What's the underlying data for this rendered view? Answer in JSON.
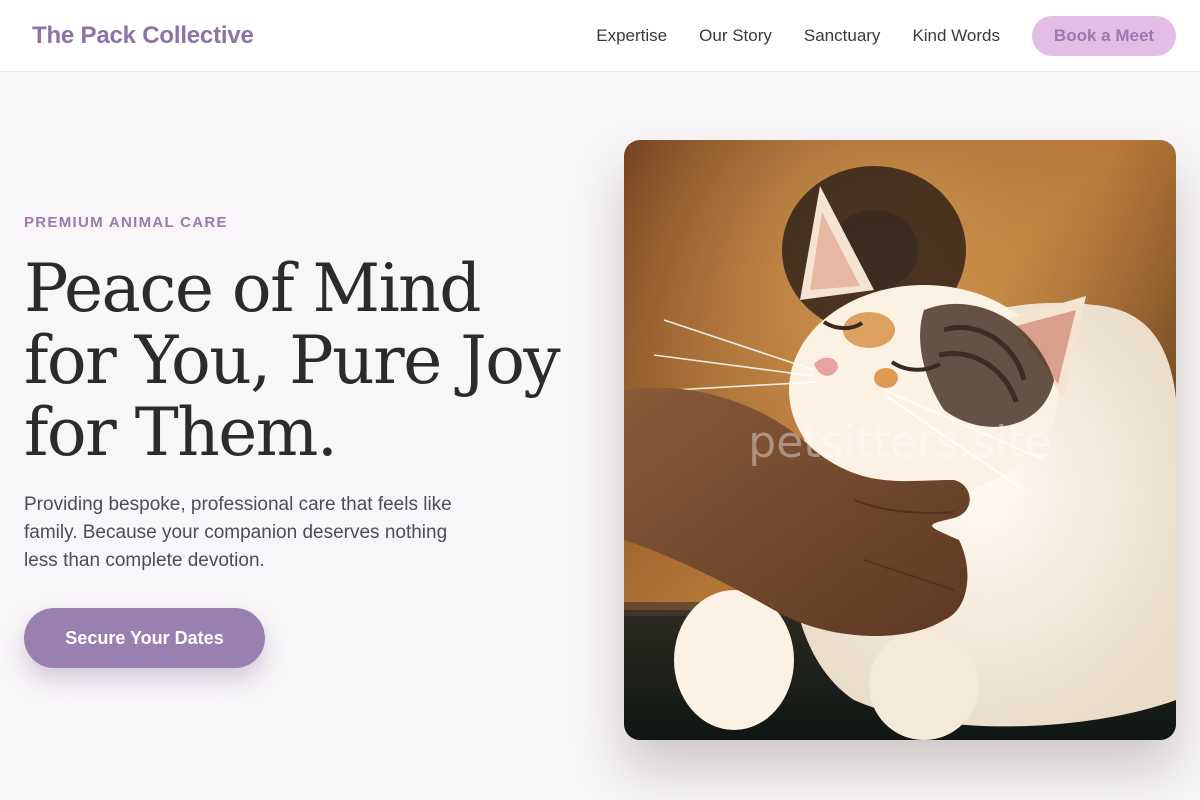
{
  "nav": {
    "brand": "The Pack Collective",
    "links": [
      "Expertise",
      "Our Story",
      "Sanctuary",
      "Kind Words"
    ],
    "cta_label": "Book a Meet"
  },
  "hero": {
    "eyebrow": "PREMIUM ANIMAL CARE",
    "headline_lines": [
      "Peace of Mind",
      "for You, Pure Joy",
      "for Them."
    ],
    "subtext": "Providing bespoke, professional care that feels like family. Because your companion deserves nothing less than complete devotion.",
    "cta_label": "Secure Your Dates",
    "image": {
      "subject": "cat-being-petted-photo",
      "watermark": "petsitters.site"
    }
  },
  "colors": {
    "brand": "#8d73a6",
    "accent": "#9a7fb1",
    "nav_cta_bg": "#e2bde6",
    "page_bg": "#f8f6f8"
  }
}
